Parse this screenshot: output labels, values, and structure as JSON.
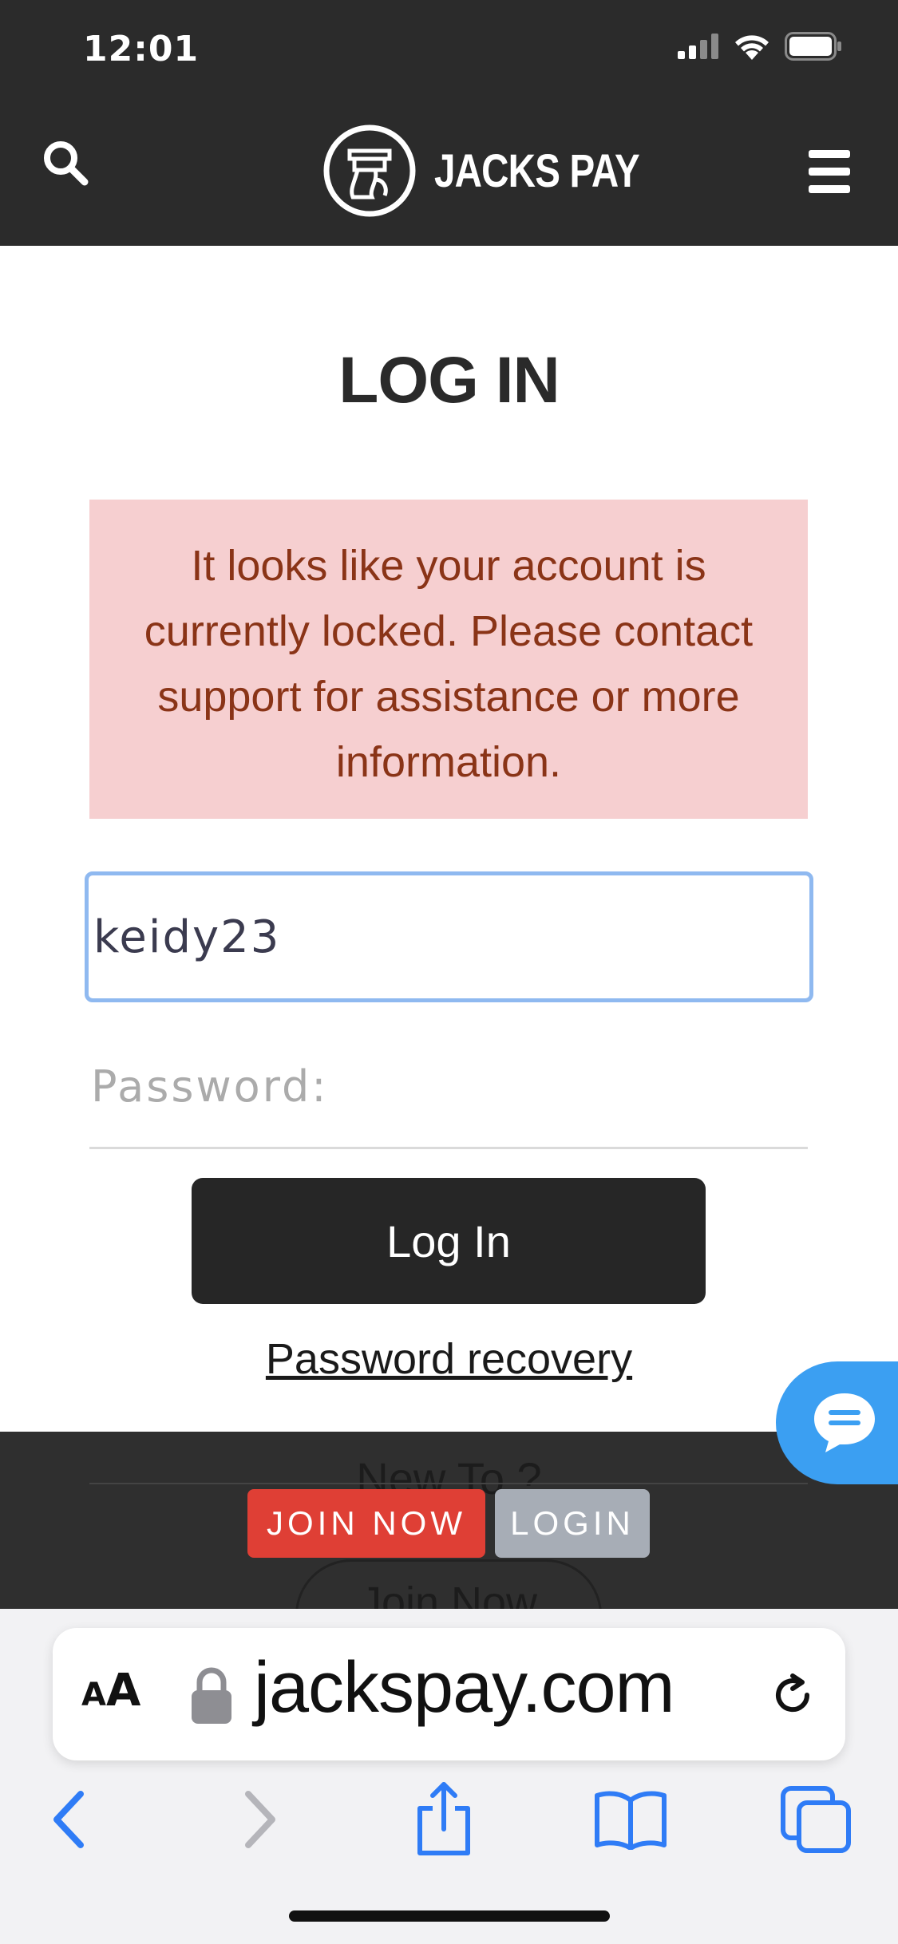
{
  "status_bar": {
    "time": "12:01"
  },
  "header": {
    "logo_text": "JACKS PAY"
  },
  "main": {
    "title": "LOG IN",
    "alert_message": "It looks like your account is currently locked. Please contact support for assistance or more information.",
    "username": {
      "value": "keidy23"
    },
    "password": {
      "placeholder": "Password:"
    },
    "login_button": "Log In",
    "recovery_link": "Password recovery"
  },
  "footer": {
    "new_to": "New To ?",
    "join_ghost": "Join Now",
    "join_now_button": "JOIN NOW",
    "login_button": "LOGIN"
  },
  "browser": {
    "aa_label_big": "A",
    "aa_label_small": "A",
    "url": "jackspay.com"
  },
  "colors": {
    "header_bg": "#2b2b2b",
    "alert_bg": "#f6cfd0",
    "alert_text": "#8a3417",
    "join_now": "#df3f35",
    "login_small": "#a7adb6",
    "chat_bubble": "#3b9ff2",
    "ios_blue": "#2f7cf6"
  },
  "icons": [
    "search-icon",
    "menu-icon",
    "logo-icon",
    "chat-icon",
    "lock-icon",
    "reload-icon",
    "back-icon",
    "forward-icon",
    "share-icon",
    "bookmarks-icon",
    "tabs-icon"
  ]
}
